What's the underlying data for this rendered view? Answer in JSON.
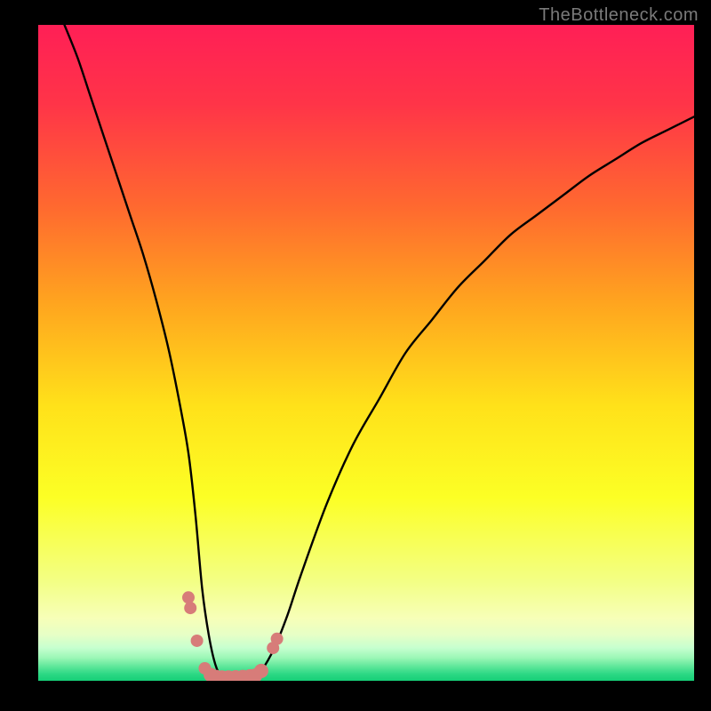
{
  "watermark": "TheBottleneck.com",
  "chart_data": {
    "type": "line",
    "title": "",
    "xlabel": "",
    "ylabel": "",
    "xlim": [
      0,
      100
    ],
    "ylim": [
      0,
      100
    ],
    "series": [
      {
        "name": "bottleneck-curve",
        "x": [
          4,
          6,
          8,
          10,
          12,
          14,
          16,
          18,
          20,
          22,
          23,
          24,
          25,
          26,
          27,
          28,
          29,
          30,
          32,
          33,
          34,
          36,
          38,
          40,
          44,
          48,
          52,
          56,
          60,
          64,
          68,
          72,
          76,
          80,
          84,
          88,
          92,
          96,
          100
        ],
        "y": [
          100,
          95,
          89,
          83,
          77,
          71,
          65,
          58,
          50,
          40,
          34,
          25,
          14,
          7,
          2.5,
          0.5,
          0.5,
          0.5,
          0.5,
          0.8,
          1.5,
          5,
          10,
          16,
          27,
          36,
          43,
          50,
          55,
          60,
          64,
          68,
          71,
          74,
          77,
          79.5,
          82,
          84,
          86
        ]
      }
    ],
    "markers": {
      "name": "data-points",
      "color": "#d77c79",
      "radius_small": 7,
      "radius_large": 8,
      "points": [
        {
          "x": 22.9,
          "y": 12.7,
          "r": "small"
        },
        {
          "x": 23.2,
          "y": 11.1,
          "r": "small"
        },
        {
          "x": 24.2,
          "y": 6.1,
          "r": "small"
        },
        {
          "x": 25.4,
          "y": 1.9,
          "r": "small"
        },
        {
          "x": 26.3,
          "y": 0.9,
          "r": "large"
        },
        {
          "x": 27.1,
          "y": 0.6,
          "r": "large"
        },
        {
          "x": 28.0,
          "y": 0.5,
          "r": "large"
        },
        {
          "x": 29.0,
          "y": 0.5,
          "r": "large"
        },
        {
          "x": 30.1,
          "y": 0.55,
          "r": "large"
        },
        {
          "x": 31.2,
          "y": 0.6,
          "r": "large"
        },
        {
          "x": 32.3,
          "y": 0.7,
          "r": "large"
        },
        {
          "x": 33.1,
          "y": 0.8,
          "r": "large"
        },
        {
          "x": 34.0,
          "y": 1.5,
          "r": "large"
        },
        {
          "x": 35.8,
          "y": 5.0,
          "r": "small"
        },
        {
          "x": 36.4,
          "y": 6.4,
          "r": "small"
        }
      ]
    },
    "background": {
      "type": "vertical-gradient",
      "stops": [
        {
          "pos": 0.0,
          "color": "#ff1f56"
        },
        {
          "pos": 0.12,
          "color": "#ff3448"
        },
        {
          "pos": 0.28,
          "color": "#ff6a2f"
        },
        {
          "pos": 0.42,
          "color": "#ffa31f"
        },
        {
          "pos": 0.58,
          "color": "#ffe11a"
        },
        {
          "pos": 0.72,
          "color": "#fcff25"
        },
        {
          "pos": 0.85,
          "color": "#f3ff86"
        },
        {
          "pos": 0.905,
          "color": "#f7ffb8"
        },
        {
          "pos": 0.93,
          "color": "#e6ffc6"
        },
        {
          "pos": 0.95,
          "color": "#c6ffcf"
        },
        {
          "pos": 0.965,
          "color": "#9bf7b6"
        },
        {
          "pos": 0.978,
          "color": "#5fe79a"
        },
        {
          "pos": 0.99,
          "color": "#2bd884"
        },
        {
          "pos": 1.0,
          "color": "#17cf77"
        }
      ]
    }
  }
}
